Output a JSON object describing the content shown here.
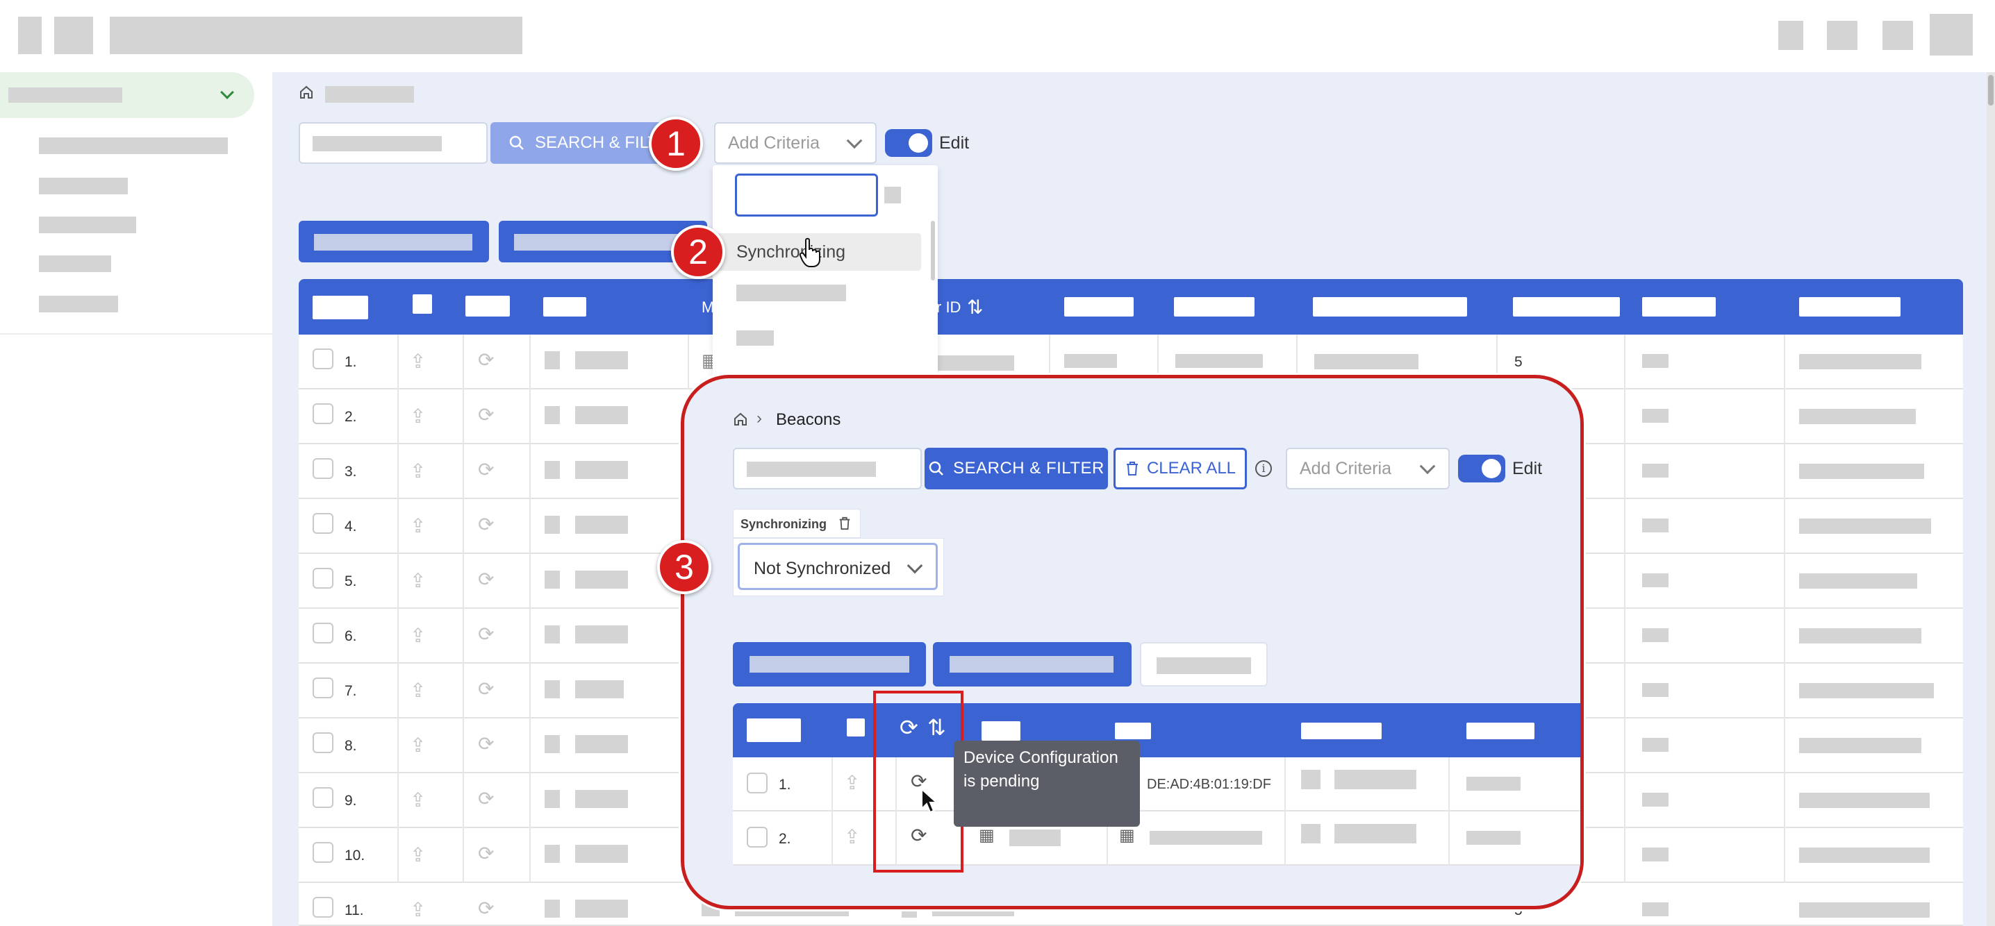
{
  "breadcrumb": {
    "current": "Beacons"
  },
  "toolbar": {
    "search_filter_label": "SEARCH & FILTER",
    "search_filter_label_clipped": "SEARCH & FILTE",
    "clear_all_label": "CLEAR ALL",
    "add_criteria_placeholder": "Add Criteria",
    "edit_label": "Edit"
  },
  "dropdown": {
    "options": [
      "Synchronizing"
    ]
  },
  "filter": {
    "chip_label": "Synchronizing",
    "selected_value": "Not Synchronized"
  },
  "table": {
    "partial_header_m": "M",
    "partial_header_id": "r ID",
    "row_numbers": [
      "1.",
      "2.",
      "3.",
      "4.",
      "5.",
      "6.",
      "7.",
      "8.",
      "9.",
      "10.",
      "11."
    ],
    "row1_count": "5",
    "row11_count": "5"
  },
  "zoom_table": {
    "row_numbers": [
      "1.",
      "2."
    ],
    "mac_address": "DE:AD:4B:01:19:DF"
  },
  "tooltip": {
    "text": "Device Configuration is pending"
  },
  "callouts": [
    "1",
    "2",
    "3"
  ],
  "colors": {
    "primary": "#3b63d1",
    "callout_red": "#d81e1e",
    "background": "#e9eef8"
  }
}
